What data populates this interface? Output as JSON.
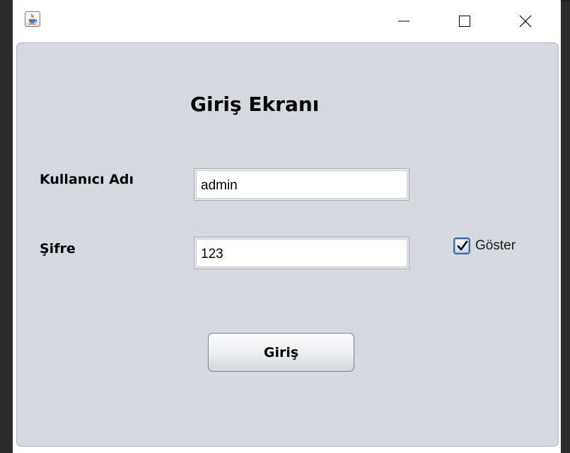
{
  "window": {
    "app_icon": "java-cup-icon",
    "controls": {
      "minimize_icon": "minimize-icon",
      "maximize_icon": "maximize-icon",
      "close_icon": "close-icon"
    }
  },
  "form": {
    "title": "Giriş Ekranı",
    "username": {
      "label": "Kullanıcı Adı",
      "value": "admin"
    },
    "password": {
      "label": "Şifre",
      "value": "123"
    },
    "show_password": {
      "label": "Göster",
      "checked": true,
      "icon": "checkmark-icon"
    },
    "submit_label": "Giriş"
  },
  "colors": {
    "panel_background": "#d6d9e0",
    "titlebar_background": "#ffffff",
    "desktop_background": "#2b2b2b"
  }
}
